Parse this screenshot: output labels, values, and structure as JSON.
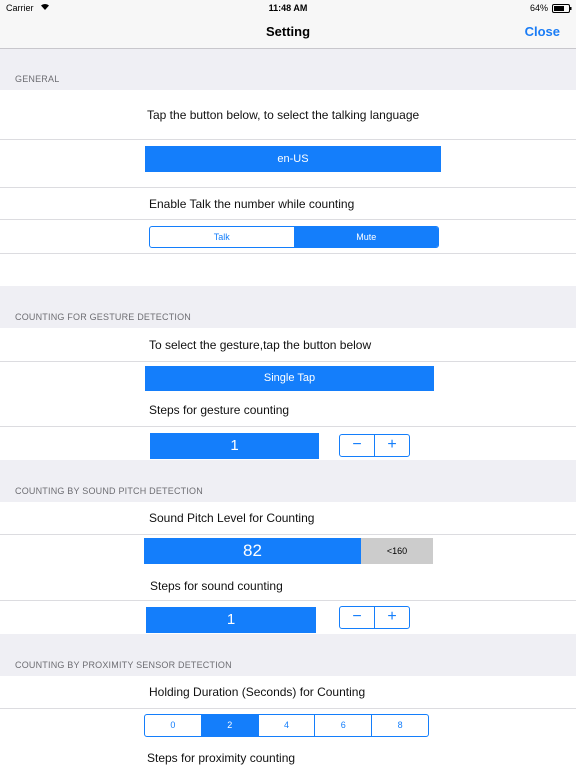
{
  "status": {
    "carrier": "Carrier",
    "time": "11:48 AM",
    "battery": "64%"
  },
  "nav": {
    "title": "Setting",
    "close": "Close"
  },
  "general": {
    "header": "GENERAL",
    "language_prompt": "Tap the button below, to select the talking language",
    "language_value": "en-US",
    "talk_prompt": "Enable Talk the number while counting",
    "talk_options": [
      "Talk",
      "Mute"
    ],
    "talk_selected": "Mute"
  },
  "gesture": {
    "header": "COUNTING FOR GESTURE DETECTION",
    "prompt": "To select the gesture,tap the button below",
    "value": "Single Tap",
    "steps_label": "Steps for gesture counting",
    "steps_value": "1"
  },
  "sound": {
    "header": "COUNTING BY SOUND PITCH DETECTION",
    "level_label": "Sound Pitch Level for Counting",
    "level_value": "82",
    "level_threshold": "<160",
    "steps_label": "Steps for sound counting",
    "steps_value": "1"
  },
  "proximity": {
    "header": "COUNTING BY PROXIMITY SENSOR DETECTION",
    "duration_label": "Holding Duration (Seconds) for Counting",
    "duration_options": [
      "0",
      "2",
      "4",
      "6",
      "8"
    ],
    "duration_selected": "2",
    "steps_label": "Steps for proximity counting"
  },
  "icons": {
    "wifi": "wifi-icon",
    "battery": "battery-icon",
    "minus": "minus-icon",
    "plus": "plus-icon"
  },
  "colors": {
    "accent": "#147efb",
    "background": "#efeff4"
  }
}
